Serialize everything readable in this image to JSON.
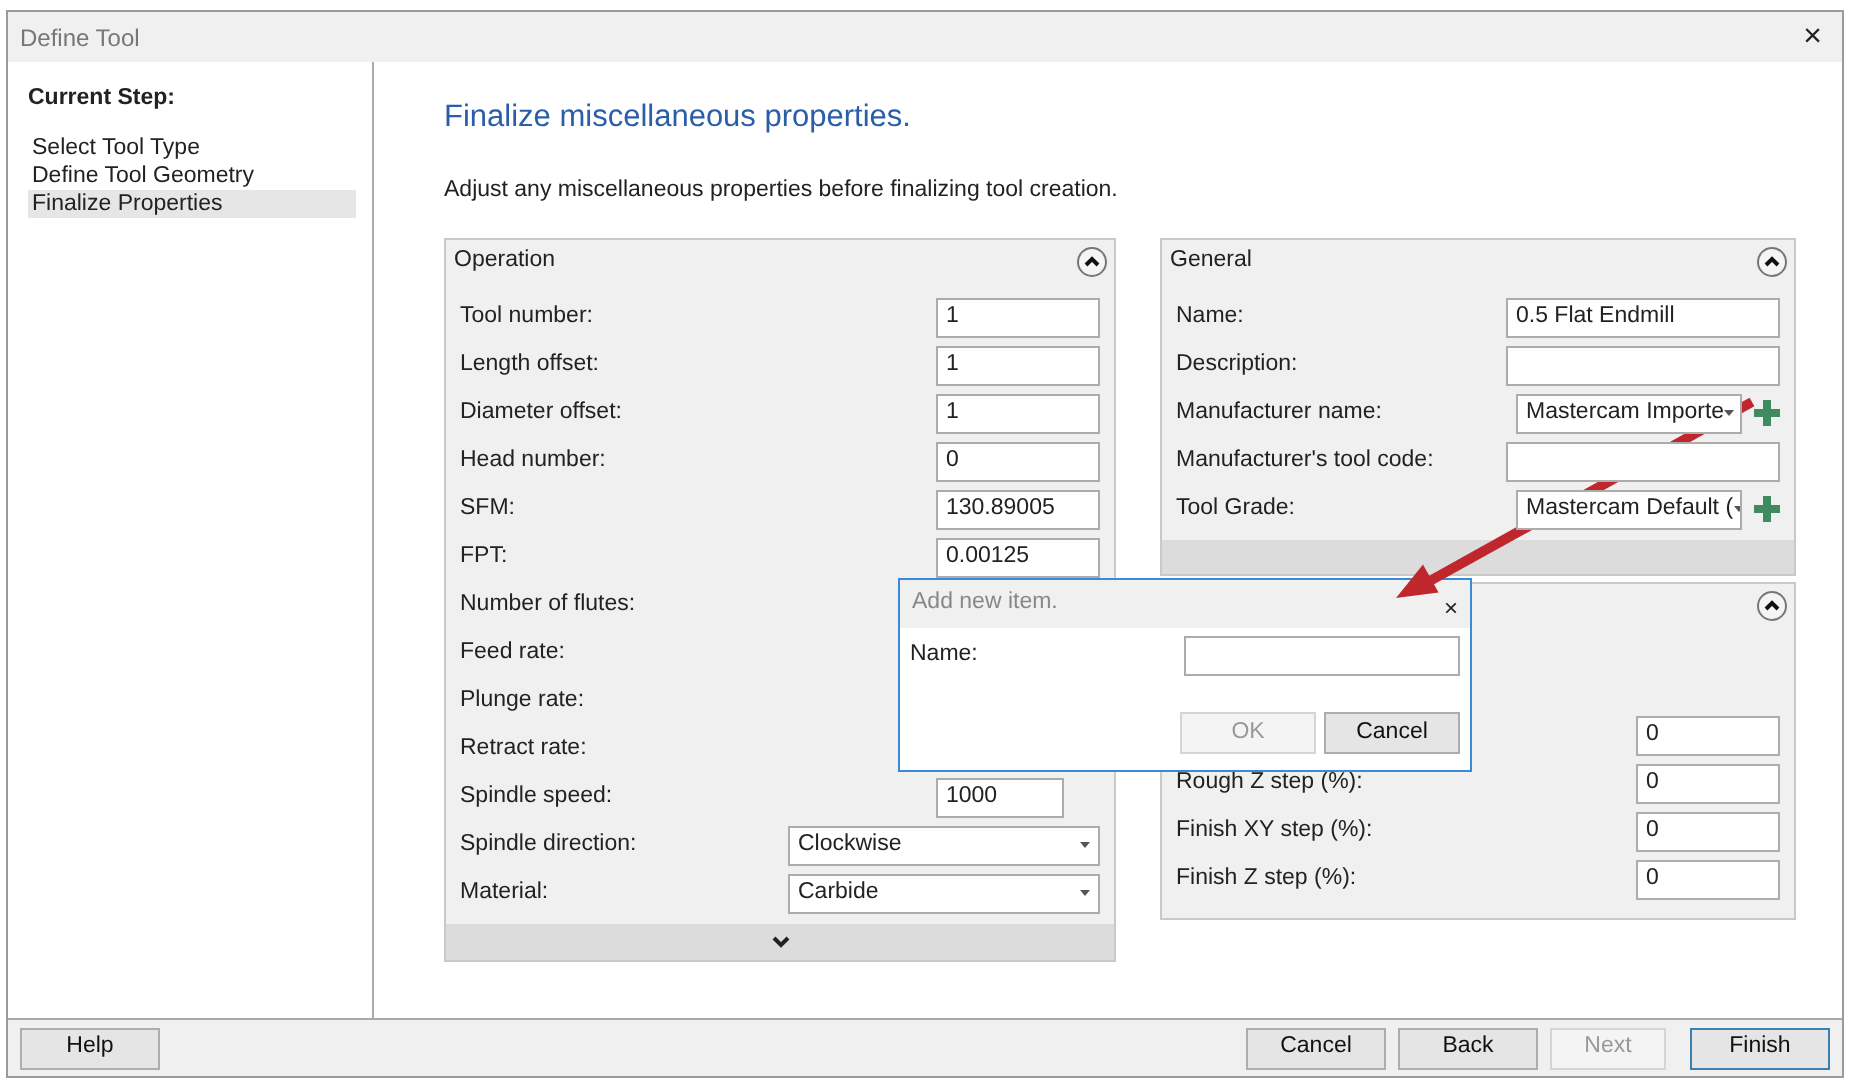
{
  "window": {
    "title": "Define Tool",
    "close": "×"
  },
  "sidebar": {
    "heading": "Current Step:",
    "steps": [
      {
        "label": "Select Tool Type",
        "selected": false
      },
      {
        "label": "Define Tool Geometry",
        "selected": false
      },
      {
        "label": "Finalize Properties",
        "selected": true
      }
    ]
  },
  "page": {
    "title": "Finalize miscellaneous properties.",
    "subtitle": "Adjust any miscellaneous properties before finalizing tool creation."
  },
  "operation": {
    "title": "Operation",
    "rows": [
      {
        "label": "Tool number:",
        "kind": "text",
        "value": "1"
      },
      {
        "label": "Length offset:",
        "kind": "text",
        "value": "1"
      },
      {
        "label": "Diameter offset:",
        "kind": "text",
        "value": "1"
      },
      {
        "label": "Head number:",
        "kind": "text",
        "value": "0"
      },
      {
        "label": "SFM:",
        "kind": "text",
        "value": "130.89005"
      },
      {
        "label": "FPT:",
        "kind": "text",
        "value": "0.00125"
      },
      {
        "label": "Number of flutes:",
        "kind": "hidden"
      },
      {
        "label": "Feed rate:",
        "kind": "hidden"
      },
      {
        "label": "Plunge rate:",
        "kind": "hidden"
      },
      {
        "label": "Retract rate:",
        "kind": "hidden"
      },
      {
        "label": "Spindle speed:",
        "kind": "short",
        "value": "1000"
      },
      {
        "label": "Spindle direction:",
        "kind": "select",
        "value": "Clockwise"
      },
      {
        "label": "Material:",
        "kind": "select",
        "value": "Carbide"
      }
    ]
  },
  "general": {
    "title": "General",
    "rows": [
      {
        "label": "Name:",
        "kind": "text",
        "value": "0.5 Flat Endmill"
      },
      {
        "label": "Description:",
        "kind": "text"
      },
      {
        "label": "Manufacturer name:",
        "kind": "select",
        "value": "Mastercam Importe",
        "add": true
      },
      {
        "label": "Manufacturer's tool code:",
        "kind": "text"
      },
      {
        "label": "Tool Grade:",
        "kind": "select",
        "value": "Mastercam Default (",
        "add": true
      }
    ]
  },
  "panel_3": {
    "rows": [
      {
        "kind": "text",
        "value": "0"
      },
      {
        "label": "Rough Z step (%):",
        "kind": "text",
        "value": "0"
      },
      {
        "label": "Finish XY step (%):",
        "kind": "text",
        "value": "0"
      },
      {
        "label": "Finish Z step (%):",
        "kind": "text",
        "value": "0"
      }
    ]
  },
  "dialog": {
    "title": "Add new item.",
    "close": "×",
    "name_label": "Name:",
    "buttons": [
      {
        "label": "OK",
        "disabled": true
      },
      {
        "label": "Cancel",
        "disabled": false
      }
    ]
  },
  "footer": {
    "left_buttons": [
      {
        "label": "Help",
        "disabled": false,
        "default": false
      }
    ],
    "right_buttons": [
      {
        "label": "Cancel",
        "disabled": false,
        "default": false
      },
      {
        "label": "Back",
        "disabled": false,
        "default": false
      },
      {
        "label": "Next",
        "disabled": true,
        "default": false
      },
      {
        "label": "Finish",
        "disabled": false,
        "default": true
      }
    ]
  }
}
